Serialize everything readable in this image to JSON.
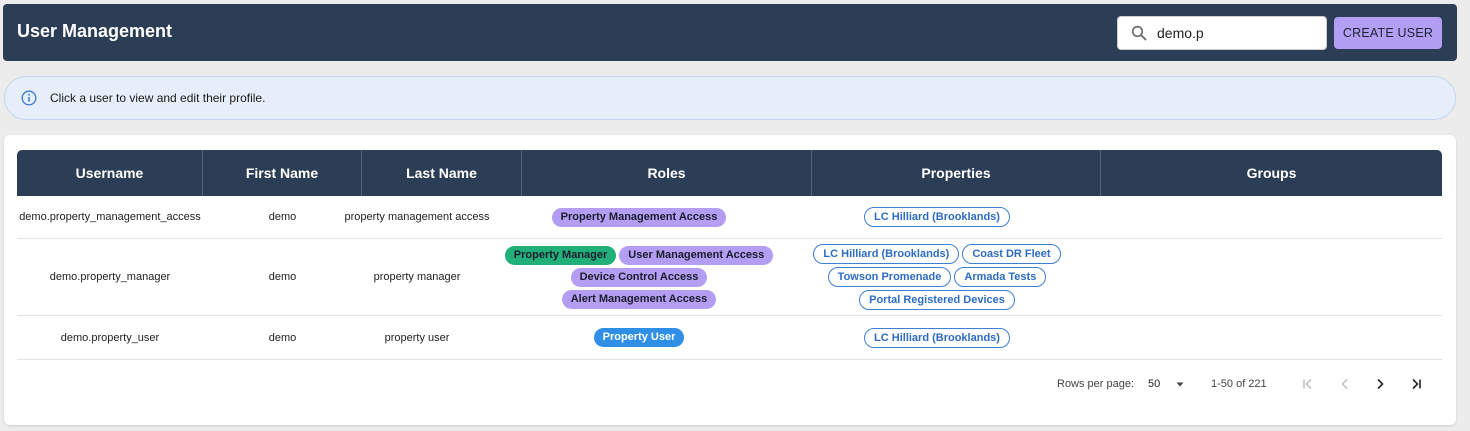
{
  "header": {
    "title": "User Management",
    "search_value": "demo.p",
    "create_button": "CREATE USER"
  },
  "info_banner": {
    "text": "Click a user to view and edit their profile."
  },
  "table": {
    "columns": [
      "Username",
      "First Name",
      "Last Name",
      "Roles",
      "Properties",
      "Groups"
    ],
    "rows": [
      {
        "username": "demo.property_management_access",
        "first_name": "demo",
        "last_name": "property management access",
        "roles": [
          [
            "Property Management Access"
          ]
        ],
        "properties": [
          [
            "LC Hilliard (Brooklands)"
          ]
        ]
      },
      {
        "username": "demo.property_manager",
        "first_name": "demo",
        "last_name": "property manager",
        "roles": [
          [
            "Property Manager",
            "User Management Access"
          ],
          [
            "Device Control Access"
          ],
          [
            "Alert Management Access"
          ]
        ],
        "properties": [
          [
            "LC Hilliard (Brooklands)",
            "Coast DR Fleet"
          ],
          [
            "Towson Promenade",
            "Armada Tests"
          ],
          [
            "Portal Registered Devices"
          ]
        ]
      },
      {
        "username": "demo.property_user",
        "first_name": "demo",
        "last_name": "property user",
        "roles": [
          [
            "Property User"
          ]
        ],
        "properties": [
          [
            "LC Hilliard (Brooklands)"
          ]
        ]
      }
    ]
  },
  "role_colors": {
    "Property Management Access": "#b39ef3",
    "Property Manager": "#22b07a",
    "User Management Access": "#b39ef3",
    "Device Control Access": "#b39ef3",
    "Alert Management Access": "#b39ef3",
    "Property User": "#2f8fe6"
  },
  "role_text_colors": {
    "Property User": "#ffffff"
  },
  "pagination": {
    "rows_per_page_label": "Rows per page:",
    "rows_per_page": "50",
    "range": "1-50 of 221"
  },
  "icons": {
    "search": "search-icon",
    "info": "info-icon",
    "rpp_dropdown": "caret-down-icon",
    "first": "first-page-icon",
    "prev": "prev-page-icon",
    "next": "next-page-icon",
    "last": "last-page-icon"
  },
  "colors": {
    "header_bg": "#2c3e55",
    "accent_button": "#b29ef2",
    "info_bg": "#e6eef9",
    "property_chip_border": "#3d7fd1"
  }
}
